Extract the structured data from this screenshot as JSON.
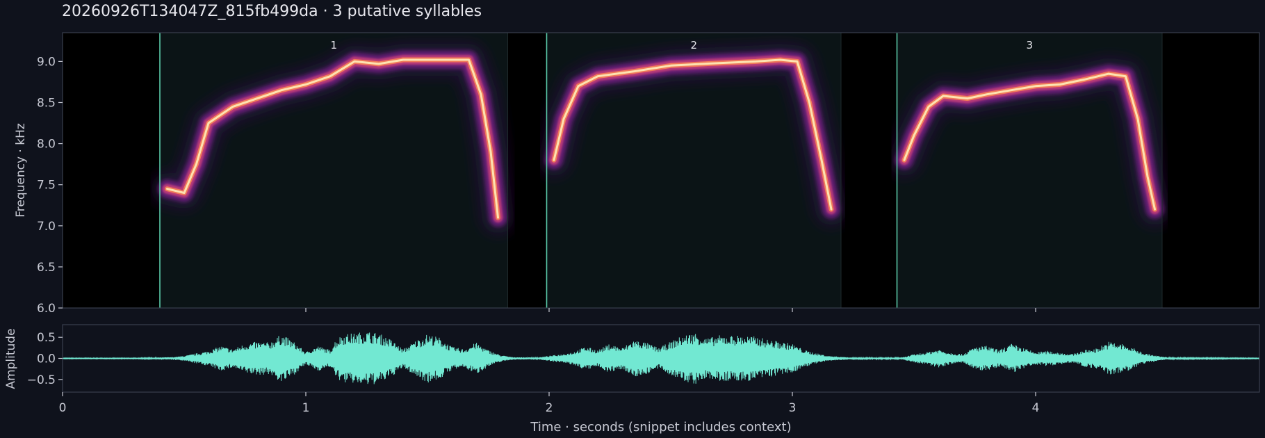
{
  "title": "20260926T134047Z_815fb499da  ·  3 putative syllables",
  "colors": {
    "background": "#0f121c",
    "spectrogram_bg": "#000000",
    "syllable_region": "#0b1416",
    "boundary": "#5ac8a8",
    "waveform": "#72e8d2",
    "axis": "#3a3f4e",
    "text": "#e8e8ee",
    "label": "#c8cad4"
  },
  "chart_data": [
    {
      "type": "heatmap",
      "name": "spectrogram",
      "ylabel": "Frequency · kHz",
      "xlim": [
        0,
        4.92
      ],
      "ylim": [
        6.0,
        9.35
      ],
      "yticks": [
        6.0,
        6.5,
        7.0,
        7.5,
        8.0,
        8.5,
        9.0
      ],
      "ytick_labels": [
        "6.0",
        "6.5",
        "7.0",
        "7.5",
        "8.0",
        "8.5",
        "9.0"
      ],
      "xticks": [
        1,
        2,
        3,
        4
      ],
      "grid": false,
      "colormap": "magma",
      "syllables": [
        {
          "label": "1",
          "start": 0.4,
          "end": 1.83,
          "contour": [
            [
              0.43,
              7.45
            ],
            [
              0.5,
              7.4
            ],
            [
              0.55,
              7.75
            ],
            [
              0.6,
              8.25
            ],
            [
              0.7,
              8.45
            ],
            [
              0.8,
              8.55
            ],
            [
              0.9,
              8.65
            ],
            [
              1.0,
              8.72
            ],
            [
              1.1,
              8.82
            ],
            [
              1.2,
              9.0
            ],
            [
              1.3,
              8.97
            ],
            [
              1.4,
              9.02
            ],
            [
              1.5,
              9.02
            ],
            [
              1.6,
              9.02
            ],
            [
              1.67,
              9.02
            ],
            [
              1.72,
              8.6
            ],
            [
              1.76,
              7.9
            ],
            [
              1.79,
              7.1
            ]
          ]
        },
        {
          "label": "2",
          "start": 1.99,
          "end": 3.2,
          "contour": [
            [
              2.02,
              7.8
            ],
            [
              2.06,
              8.3
            ],
            [
              2.12,
              8.7
            ],
            [
              2.2,
              8.82
            ],
            [
              2.35,
              8.88
            ],
            [
              2.5,
              8.95
            ],
            [
              2.7,
              8.98
            ],
            [
              2.85,
              9.0
            ],
            [
              2.95,
              9.02
            ],
            [
              3.02,
              9.0
            ],
            [
              3.07,
              8.5
            ],
            [
              3.12,
              7.8
            ],
            [
              3.16,
              7.2
            ]
          ]
        },
        {
          "label": "3",
          "start": 3.43,
          "end": 4.52,
          "contour": [
            [
              3.46,
              7.8
            ],
            [
              3.5,
              8.1
            ],
            [
              3.56,
              8.45
            ],
            [
              3.62,
              8.58
            ],
            [
              3.72,
              8.55
            ],
            [
              3.8,
              8.6
            ],
            [
              3.9,
              8.65
            ],
            [
              4.0,
              8.7
            ],
            [
              4.1,
              8.72
            ],
            [
              4.2,
              8.78
            ],
            [
              4.3,
              8.85
            ],
            [
              4.37,
              8.82
            ],
            [
              4.42,
              8.3
            ],
            [
              4.46,
              7.6
            ],
            [
              4.49,
              7.2
            ]
          ]
        }
      ]
    },
    {
      "type": "area",
      "name": "waveform",
      "ylabel": "Amplitude",
      "xlabel": "Time · seconds (snippet includes context)",
      "xlim": [
        0,
        4.92
      ],
      "ylim": [
        -0.8,
        0.8
      ],
      "yticks": [
        -0.5,
        0.0,
        0.5
      ],
      "ytick_labels": [
        "−0.5",
        "0.0",
        "0.5"
      ],
      "xticks": [
        0,
        1,
        2,
        3,
        4
      ],
      "xtick_labels": [
        "0",
        "1",
        "2",
        "3",
        "4"
      ],
      "grid": false,
      "envelope": [
        [
          0.0,
          0.01
        ],
        [
          0.3,
          0.01
        ],
        [
          0.45,
          0.03
        ],
        [
          0.5,
          0.06
        ],
        [
          0.55,
          0.12
        ],
        [
          0.6,
          0.18
        ],
        [
          0.65,
          0.3
        ],
        [
          0.7,
          0.22
        ],
        [
          0.75,
          0.35
        ],
        [
          0.8,
          0.4
        ],
        [
          0.85,
          0.38
        ],
        [
          0.88,
          0.5
        ],
        [
          0.9,
          0.58
        ],
        [
          0.95,
          0.4
        ],
        [
          1.0,
          0.15
        ],
        [
          1.05,
          0.3
        ],
        [
          1.1,
          0.2
        ],
        [
          1.12,
          0.42
        ],
        [
          1.15,
          0.58
        ],
        [
          1.2,
          0.6
        ],
        [
          1.25,
          0.65
        ],
        [
          1.3,
          0.6
        ],
        [
          1.35,
          0.45
        ],
        [
          1.4,
          0.22
        ],
        [
          1.45,
          0.42
        ],
        [
          1.5,
          0.58
        ],
        [
          1.55,
          0.5
        ],
        [
          1.6,
          0.28
        ],
        [
          1.65,
          0.22
        ],
        [
          1.7,
          0.38
        ],
        [
          1.75,
          0.2
        ],
        [
          1.8,
          0.08
        ],
        [
          1.85,
          0.03
        ],
        [
          1.95,
          0.02
        ],
        [
          2.05,
          0.1
        ],
        [
          2.1,
          0.16
        ],
        [
          2.15,
          0.28
        ],
        [
          2.2,
          0.2
        ],
        [
          2.25,
          0.35
        ],
        [
          2.3,
          0.25
        ],
        [
          2.35,
          0.45
        ],
        [
          2.4,
          0.38
        ],
        [
          2.45,
          0.25
        ],
        [
          2.5,
          0.4
        ],
        [
          2.55,
          0.55
        ],
        [
          2.6,
          0.62
        ],
        [
          2.65,
          0.48
        ],
        [
          2.7,
          0.55
        ],
        [
          2.75,
          0.55
        ],
        [
          2.8,
          0.55
        ],
        [
          2.85,
          0.52
        ],
        [
          2.9,
          0.45
        ],
        [
          2.95,
          0.4
        ],
        [
          3.0,
          0.35
        ],
        [
          3.05,
          0.2
        ],
        [
          3.1,
          0.12
        ],
        [
          3.15,
          0.06
        ],
        [
          3.25,
          0.02
        ],
        [
          3.45,
          0.02
        ],
        [
          3.5,
          0.1
        ],
        [
          3.55,
          0.15
        ],
        [
          3.6,
          0.22
        ],
        [
          3.65,
          0.14
        ],
        [
          3.7,
          0.1
        ],
        [
          3.75,
          0.28
        ],
        [
          3.8,
          0.3
        ],
        [
          3.85,
          0.2
        ],
        [
          3.9,
          0.35
        ],
        [
          3.95,
          0.25
        ],
        [
          4.0,
          0.15
        ],
        [
          4.05,
          0.18
        ],
        [
          4.1,
          0.14
        ],
        [
          4.15,
          0.1
        ],
        [
          4.2,
          0.2
        ],
        [
          4.25,
          0.24
        ],
        [
          4.3,
          0.4
        ],
        [
          4.35,
          0.36
        ],
        [
          4.4,
          0.25
        ],
        [
          4.45,
          0.12
        ],
        [
          4.5,
          0.06
        ],
        [
          4.55,
          0.02
        ],
        [
          4.92,
          0.01
        ]
      ]
    }
  ]
}
